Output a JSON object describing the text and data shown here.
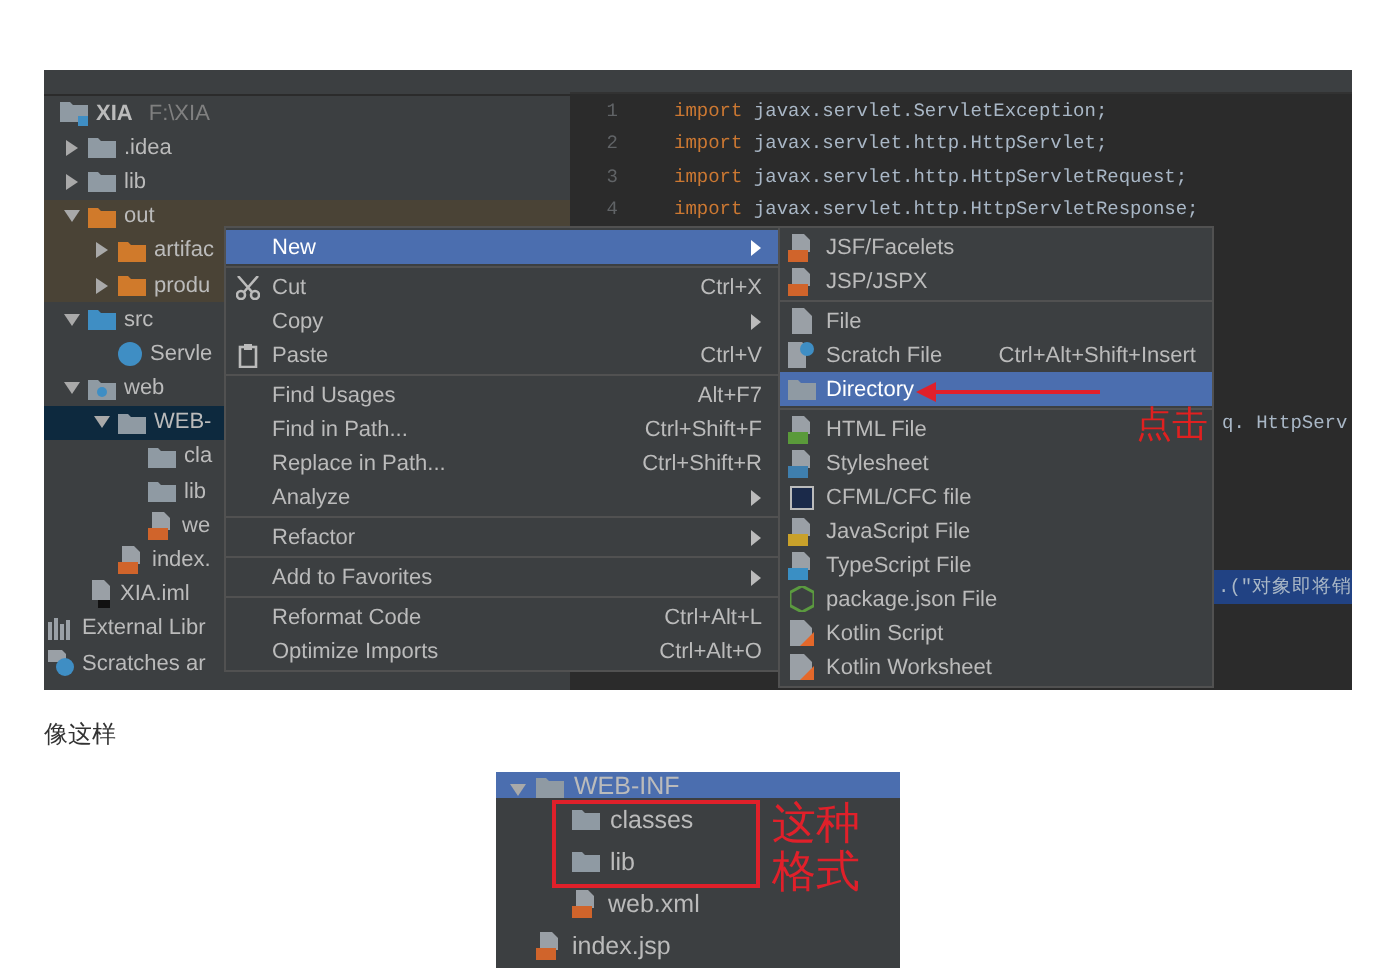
{
  "screenshot_1": {
    "project_root": {
      "name": "XIA",
      "path": "F:\\XIA"
    },
    "tree": [
      {
        "label": ".idea",
        "kind": "folder",
        "expanded": false,
        "selected": false
      },
      {
        "label": "lib",
        "kind": "folder",
        "expanded": false,
        "selected": false
      },
      {
        "label": "out",
        "kind": "folder-excluded",
        "expanded": true,
        "selected": false,
        "children": [
          {
            "label": "artifac",
            "kind": "folder-excluded",
            "expanded": false,
            "selected": false
          },
          {
            "label": "produ",
            "kind": "folder-excluded",
            "expanded": false,
            "selected": false
          }
        ]
      },
      {
        "label": "src",
        "kind": "folder-source",
        "expanded": true,
        "selected": false,
        "children": [
          {
            "label": "Servle",
            "kind": "java-class",
            "selected": false
          }
        ]
      },
      {
        "label": "web",
        "kind": "folder-web",
        "expanded": true,
        "selected": false,
        "children": [
          {
            "label": "WEB-",
            "kind": "folder",
            "expanded": true,
            "selected": true,
            "children": [
              {
                "label": "cla",
                "kind": "folder",
                "selected": false
              },
              {
                "label": "lib",
                "kind": "folder",
                "selected": false
              },
              {
                "label": "we",
                "kind": "xml-file",
                "selected": false
              }
            ]
          },
          {
            "label": "index.",
            "kind": "jsp-file",
            "selected": false
          }
        ]
      },
      {
        "label": "XIA.iml",
        "kind": "iml-file",
        "selected": false
      },
      {
        "label": "External Libr",
        "kind": "libraries",
        "selected": false,
        "root": true
      },
      {
        "label": "Scratches ar",
        "kind": "scratches",
        "selected": false,
        "root": true
      }
    ],
    "editor": {
      "lines": [
        {
          "number": "1",
          "keyword": "import",
          "code": "javax.servlet.ServletException;"
        },
        {
          "number": "2",
          "keyword": "import",
          "code": "javax.servlet.http.HttpServlet;"
        },
        {
          "number": "3",
          "keyword": "import",
          "code": "javax.servlet.http.HttpServletRequest;"
        },
        {
          "number": "4",
          "keyword": "import",
          "code": "javax.servlet.http.HttpServletResponse;"
        }
      ],
      "fragments": [
        {
          "text": "q. HttpServ",
          "highlighted": false
        },
        {
          "text": ".(\"对象即将销",
          "highlighted": true
        }
      ]
    },
    "context_menu": [
      [
        {
          "label": "New",
          "has_submenu": true,
          "selected": true
        }
      ],
      [
        {
          "label": "Cut",
          "kind": "scissors",
          "shortcut": "Ctrl+X",
          "selected": false
        },
        {
          "label": "Copy",
          "has_submenu": true,
          "selected": false
        },
        {
          "label": "Paste",
          "kind": "clipboard",
          "shortcut": "Ctrl+V",
          "selected": false
        }
      ],
      [
        {
          "label": "Find Usages",
          "shortcut": "Alt+F7",
          "selected": false
        },
        {
          "label": "Find in Path...",
          "shortcut": "Ctrl+Shift+F",
          "selected": false
        },
        {
          "label": "Replace in Path...",
          "shortcut": "Ctrl+Shift+R",
          "selected": false
        },
        {
          "label": "Analyze",
          "has_submenu": true,
          "selected": false
        }
      ],
      [
        {
          "label": "Refactor",
          "has_submenu": true,
          "selected": false
        }
      ],
      [
        {
          "label": "Add to Favorites",
          "has_submenu": true,
          "selected": false
        }
      ],
      [
        {
          "label": "Reformat Code",
          "shortcut": "Ctrl+Alt+L",
          "selected": false
        },
        {
          "label": "Optimize Imports",
          "shortcut": "Ctrl+Alt+O",
          "selected": false
        }
      ]
    ],
    "submenu": [
      [
        {
          "label": "JSF/Facelets",
          "kind": "jsf",
          "selected": false
        },
        {
          "label": "JSP/JSPX",
          "kind": "jsp",
          "selected": false
        }
      ],
      [
        {
          "label": "File",
          "kind": "file",
          "selected": false
        },
        {
          "label": "Scratch File",
          "kind": "scratch",
          "shortcut": "Ctrl+Alt+Shift+Insert",
          "selected": false
        },
        {
          "label": "Directory",
          "kind": "folder",
          "selected": true
        }
      ],
      [
        {
          "label": "HTML File",
          "kind": "html",
          "selected": false
        },
        {
          "label": "Stylesheet",
          "kind": "css",
          "selected": false
        },
        {
          "label": "CFML/CFC file",
          "kind": "cfml",
          "selected": false
        },
        {
          "label": "JavaScript File",
          "kind": "js",
          "selected": false
        },
        {
          "label": "TypeScript File",
          "kind": "ts",
          "selected": false
        },
        {
          "label": "package.json File",
          "kind": "node",
          "selected": false
        },
        {
          "label": "Kotlin Script",
          "kind": "kotlin",
          "selected": false
        },
        {
          "label": "Kotlin Worksheet",
          "kind": "kotlin",
          "selected": false
        }
      ]
    ],
    "annotation": {
      "text": "点击"
    }
  },
  "caption": "像这样",
  "screenshot_2": {
    "tree": [
      {
        "label": "WEB-INF",
        "kind": "folder",
        "expanded": true,
        "selected": true,
        "children": [
          {
            "label": "classes",
            "kind": "folder",
            "selected": false
          },
          {
            "label": "lib",
            "kind": "folder",
            "selected": false
          },
          {
            "label": "web.xml",
            "kind": "xml-file",
            "selected": false
          }
        ]
      },
      {
        "label": "index.jsp",
        "kind": "jsp-file",
        "selected": false
      }
    ],
    "annotation": {
      "text": "这种格式"
    }
  }
}
